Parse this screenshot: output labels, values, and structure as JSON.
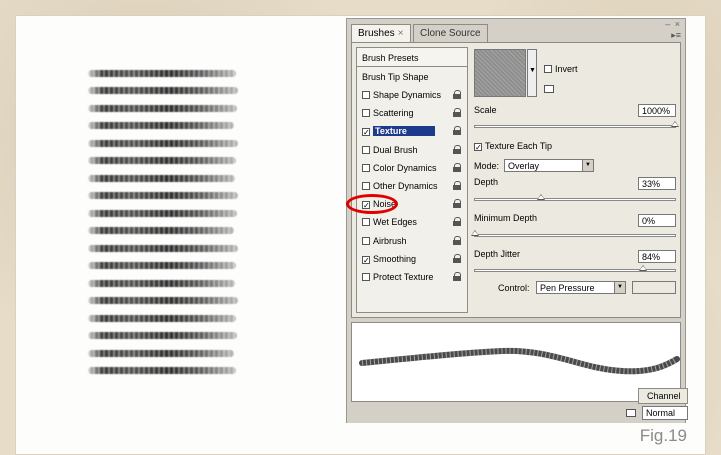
{
  "panel": {
    "tabs": [
      {
        "label": "Brushes",
        "close": "×"
      },
      {
        "label": "Clone Source"
      }
    ],
    "window_controls": "– ×",
    "brush_presets": "Brush Presets",
    "brush_tip_shape": "Brush Tip Shape",
    "options": [
      {
        "label": "Shape Dynamics",
        "checked": false
      },
      {
        "label": "Scattering",
        "checked": false
      },
      {
        "label": "Texture",
        "checked": true,
        "selected": true
      },
      {
        "label": "Dual Brush",
        "checked": false
      },
      {
        "label": "Color Dynamics",
        "checked": false
      },
      {
        "label": "Other Dynamics",
        "checked": false
      },
      {
        "label": "Noise",
        "checked": true,
        "highlighted": true
      },
      {
        "label": "Wet Edges",
        "checked": false
      },
      {
        "label": "Airbrush",
        "checked": false
      },
      {
        "label": "Smoothing",
        "checked": true
      },
      {
        "label": "Protect Texture",
        "checked": false
      }
    ],
    "texture": {
      "invert_label": "Invert",
      "invert_checked": false,
      "scale_label": "Scale",
      "scale_value": "1000%",
      "scale_fraction": 1.0,
      "texture_each_tip_label": "Texture Each Tip",
      "texture_each_tip_checked": true,
      "mode_label": "Mode:",
      "mode_value": "Overlay",
      "depth_label": "Depth",
      "depth_value": "33%",
      "depth_fraction": 0.33,
      "min_depth_label": "Minimum Depth",
      "min_depth_value": "0%",
      "min_depth_fraction": 0.0,
      "depth_jitter_label": "Depth Jitter",
      "depth_jitter_value": "84%",
      "depth_jitter_fraction": 0.84,
      "control_label": "Control:",
      "control_value": "Pen Pressure"
    }
  },
  "channels": {
    "tab_label": "Channel",
    "blend_value": "Normal"
  },
  "caption": "Fig.19",
  "colors": {
    "highlight_circle": "#e00000",
    "selected_item": "#1e3a8a"
  }
}
